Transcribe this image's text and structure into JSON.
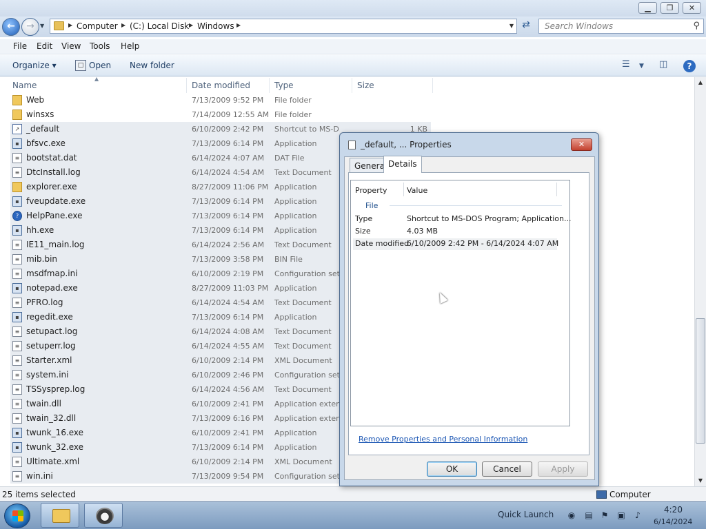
{
  "window": {
    "minimize_glyph": "▁",
    "maximize_glyph": "❐",
    "close_glyph": "✕"
  },
  "address": {
    "crumbs": [
      "Computer",
      "(C:) Local Disk",
      "Windows"
    ],
    "search_placeholder": "Search Windows"
  },
  "menu": [
    "File",
    "Edit",
    "View",
    "Tools",
    "Help"
  ],
  "commands": {
    "organize": "Organize",
    "open": "Open",
    "new_folder": "New folder"
  },
  "columns": {
    "name": "Name",
    "date": "Date modified",
    "type": "Type",
    "size": "Size"
  },
  "files": [
    {
      "name": "Web",
      "date": "7/13/2009 9:52 PM",
      "type": "File folder",
      "size": "",
      "icon": "folder",
      "selected": false
    },
    {
      "name": "winsxs",
      "date": "7/14/2009 12:55 AM",
      "type": "File folder",
      "size": "",
      "icon": "folder",
      "selected": false
    },
    {
      "name": "_default",
      "date": "6/10/2009 2:42 PM",
      "type": "Shortcut to MS-D...",
      "size": "1 KB",
      "icon": "shortcut",
      "selected": true
    },
    {
      "name": "bfsvc.exe",
      "date": "7/13/2009 6:14 PM",
      "type": "Application",
      "size": "",
      "icon": "app",
      "selected": true
    },
    {
      "name": "bootstat.dat",
      "date": "6/14/2024 4:07 AM",
      "type": "DAT File",
      "size": "",
      "icon": "file",
      "selected": true
    },
    {
      "name": "DtcInstall.log",
      "date": "6/14/2024 4:54 AM",
      "type": "Text Document",
      "size": "",
      "icon": "file",
      "selected": true
    },
    {
      "name": "explorer.exe",
      "date": "8/27/2009 11:06 PM",
      "type": "Application",
      "size": "",
      "icon": "folder",
      "selected": true
    },
    {
      "name": "fveupdate.exe",
      "date": "7/13/2009 6:14 PM",
      "type": "Application",
      "size": "",
      "icon": "app",
      "selected": true
    },
    {
      "name": "HelpPane.exe",
      "date": "7/13/2009 6:14 PM",
      "type": "Application",
      "size": "",
      "icon": "help",
      "selected": true
    },
    {
      "name": "hh.exe",
      "date": "7/13/2009 6:14 PM",
      "type": "Application",
      "size": "",
      "icon": "app",
      "selected": true
    },
    {
      "name": "IE11_main.log",
      "date": "6/14/2024 2:56 AM",
      "type": "Text Document",
      "size": "",
      "icon": "file",
      "selected": true
    },
    {
      "name": "mib.bin",
      "date": "7/13/2009 3:58 PM",
      "type": "BIN File",
      "size": "",
      "icon": "file",
      "selected": true
    },
    {
      "name": "msdfmap.ini",
      "date": "6/10/2009 2:19 PM",
      "type": "Configuration settings",
      "size": "",
      "icon": "file",
      "selected": true
    },
    {
      "name": "notepad.exe",
      "date": "8/27/2009 11:03 PM",
      "type": "Application",
      "size": "",
      "icon": "app",
      "selected": true
    },
    {
      "name": "PFRO.log",
      "date": "6/14/2024 4:54 AM",
      "type": "Text Document",
      "size": "",
      "icon": "file",
      "selected": true
    },
    {
      "name": "regedit.exe",
      "date": "7/13/2009 6:14 PM",
      "type": "Application",
      "size": "",
      "icon": "app",
      "selected": true
    },
    {
      "name": "setupact.log",
      "date": "6/14/2024 4:08 AM",
      "type": "Text Document",
      "size": "",
      "icon": "file",
      "selected": true
    },
    {
      "name": "setuperr.log",
      "date": "6/14/2024 4:55 AM",
      "type": "Text Document",
      "size": "",
      "icon": "file",
      "selected": true
    },
    {
      "name": "Starter.xml",
      "date": "6/10/2009 2:14 PM",
      "type": "XML Document",
      "size": "",
      "icon": "file",
      "selected": true
    },
    {
      "name": "system.ini",
      "date": "6/10/2009 2:46 PM",
      "type": "Configuration settings",
      "size": "",
      "icon": "file",
      "selected": true
    },
    {
      "name": "TSSysprep.log",
      "date": "6/14/2024 4:56 AM",
      "type": "Text Document",
      "size": "",
      "icon": "file",
      "selected": true
    },
    {
      "name": "twain.dll",
      "date": "6/10/2009 2:41 PM",
      "type": "Application extension",
      "size": "",
      "icon": "file",
      "selected": true
    },
    {
      "name": "twain_32.dll",
      "date": "7/13/2009 6:16 PM",
      "type": "Application extension",
      "size": "",
      "icon": "file",
      "selected": true
    },
    {
      "name": "twunk_16.exe",
      "date": "6/10/2009 2:41 PM",
      "type": "Application",
      "size": "",
      "icon": "app",
      "selected": true
    },
    {
      "name": "twunk_32.exe",
      "date": "7/13/2009 6:14 PM",
      "type": "Application",
      "size": "",
      "icon": "app",
      "selected": true
    },
    {
      "name": "Ultimate.xml",
      "date": "6/10/2009 2:14 PM",
      "type": "XML Document",
      "size": "",
      "icon": "file",
      "selected": true
    },
    {
      "name": "win.ini",
      "date": "7/13/2009 9:54 PM",
      "type": "Configuration settings",
      "size": "",
      "icon": "file",
      "selected": true
    }
  ],
  "status": {
    "left": "25 items selected",
    "right": "Computer"
  },
  "taskbar": {
    "quick_launch": "Quick Launch",
    "time": "4:20",
    "date": "6/14/2024"
  },
  "dialog": {
    "title": "_default, ... Properties",
    "close_glyph": "✕",
    "tabs": [
      "General",
      "Details"
    ],
    "active_tab": "Details",
    "header_property": "Property",
    "header_value": "Value",
    "group": "File",
    "rows": [
      {
        "property": "Type",
        "value": "Shortcut to MS-DOS Program; Application..."
      },
      {
        "property": "Size",
        "value": "4.03 MB"
      },
      {
        "property": "Date modified",
        "value": "6/10/2009 2:42 PM - 6/14/2024 4:07 AM"
      }
    ],
    "link": "Remove Properties and Personal Information",
    "ok": "OK",
    "cancel": "Cancel",
    "apply": "Apply"
  }
}
